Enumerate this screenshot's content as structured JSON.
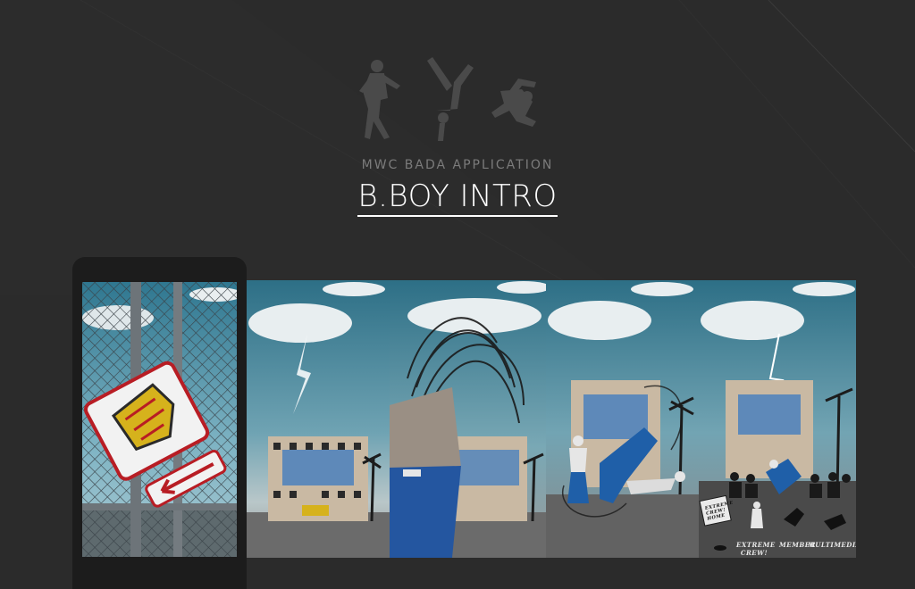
{
  "header": {
    "subtitle": "MWC BADA APPLICATION",
    "title": "B.BOY INTRO"
  },
  "screens": [
    {
      "name": "graffiti-sign-screen"
    },
    {
      "name": "lightning-building-screen"
    },
    {
      "name": "hair-flip-dancer-screen"
    },
    {
      "name": "breakdance-crew-screen"
    },
    {
      "name": "main-menu-screen"
    }
  ],
  "menu": {
    "sign_text": "EXTREME CREW! HOME",
    "items": [
      "EXTREME CREW!",
      "MEMBER",
      "MULTIMEDIA"
    ]
  },
  "colors": {
    "background": "#2b2b2b",
    "sky": "#3f8fa8",
    "pants_blue": "#1f5fa8",
    "title": "#ffffff",
    "subtitle": "#7b7b7b"
  }
}
